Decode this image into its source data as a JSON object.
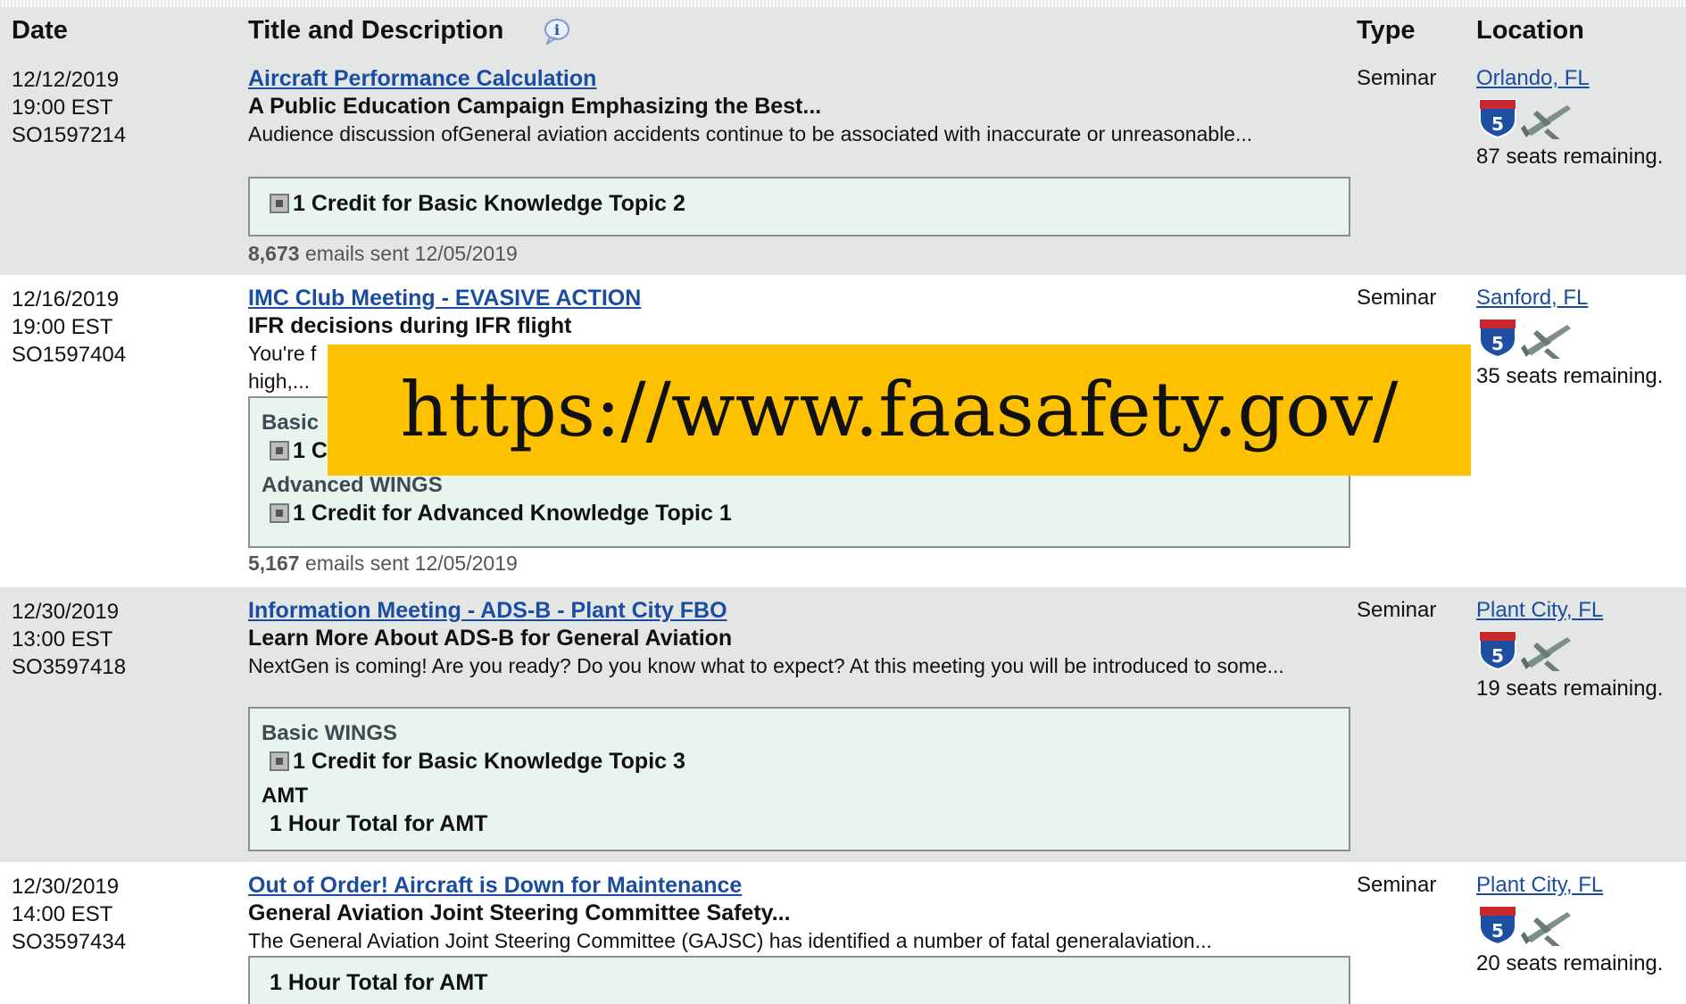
{
  "table": {
    "headers": {
      "date": "Date",
      "title": "Title and Description",
      "type": "Type",
      "location": "Location"
    }
  },
  "events": [
    {
      "date": "12/12/2019",
      "time": "19:00 EST",
      "id": "SO1597214",
      "title": "Aircraft Performance Calculation",
      "subtitle": "A Public Education Campaign Emphasizing the Best...",
      "description": "Audience discussion ofGeneral aviation accidents continue to be associated with inaccurate or unreasonable...",
      "credits": [
        {
          "category": "",
          "text": "1 Credit for Basic Knowledge Topic 2"
        }
      ],
      "emails_count": "8,673",
      "emails_text": "emails sent 12/05/2019",
      "type": "Seminar",
      "location": "Orlando, FL",
      "seats": "87 seats remaining."
    },
    {
      "date": "12/16/2019",
      "time": "19:00 EST",
      "id": "SO1597404",
      "title": "IMC Club Meeting - EVASIVE ACTION",
      "subtitle": "IFR decisions during IFR flight",
      "description_line1": "You're f",
      "description_line2": "high,...",
      "credits": [
        {
          "category": "Basic",
          "text": "1 C"
        },
        {
          "category": "Advanced WINGS",
          "text": "1 Credit for Advanced Knowledge Topic 1"
        }
      ],
      "emails_count": "5,167",
      "emails_text": "emails sent 12/05/2019",
      "type": "Seminar",
      "location": "Sanford, FL",
      "seats": "35 seats remaining."
    },
    {
      "date": "12/30/2019",
      "time": "13:00 EST",
      "id": "SO3597418",
      "title": "Information Meeting - ADS-B - Plant City FBO",
      "subtitle": "Learn More About ADS-B for General Aviation",
      "description": "NextGen is coming! Are you ready? Do you know what to expect? At this meeting you will be introduced to some...",
      "credits": [
        {
          "category": "Basic WINGS",
          "text": "1 Credit for Basic Knowledge Topic 3"
        },
        {
          "category": "AMT",
          "text": "1 Hour Total for AMT"
        }
      ],
      "type": "Seminar",
      "location": "Plant City, FL",
      "seats": "19 seats remaining."
    },
    {
      "date": "12/30/2019",
      "time": "14:00 EST",
      "id": "SO3597434",
      "title": "Out of Order! Aircraft is Down for Maintenance",
      "subtitle": "General Aviation Joint Steering Committee Safety...",
      "description": "The General Aviation Joint Steering Committee (GAJSC) has identified a number of fatal generalaviation...",
      "credits": [
        {
          "category": "",
          "text": "1 Hour Total for AMT"
        }
      ],
      "type": "Seminar",
      "location": "Plant City, FL",
      "seats": "20 seats remaining."
    }
  ],
  "overlay": {
    "url": "https://www.faasafety.gov/"
  },
  "icons": {
    "info": "info-icon",
    "interstate": "interstate-shield-icon",
    "airplane": "airplane-icon"
  },
  "colors": {
    "header_bg": "#e4e6e6",
    "link": "#1a4da0",
    "credit_bg": "#e8f4ee",
    "overlay_bg": "#fdc100"
  }
}
